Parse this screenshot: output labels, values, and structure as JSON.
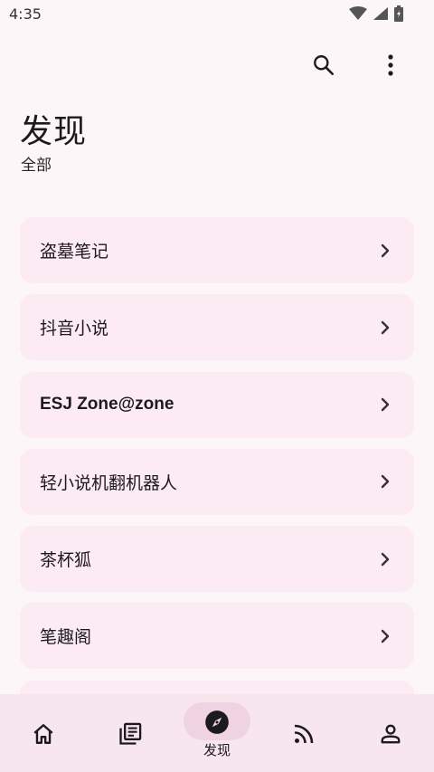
{
  "status_bar": {
    "time": "4:35"
  },
  "header": {
    "title": "发现",
    "subtitle": "全部",
    "actions": [
      {
        "icon": "search-icon"
      },
      {
        "icon": "more-vert-icon"
      }
    ]
  },
  "sources": [
    {
      "label": "盗墓笔记"
    },
    {
      "label": "抖音小说"
    },
    {
      "label": "ESJ Zone@zone"
    },
    {
      "label": "轻小说机翻机器人"
    },
    {
      "label": "茶杯狐"
    },
    {
      "label": "笔趣阁"
    },
    {
      "label": ""
    }
  ],
  "bottom_nav": {
    "items": [
      {
        "icon": "home-icon",
        "label": ""
      },
      {
        "icon": "library-icon",
        "label": ""
      },
      {
        "icon": "compass-icon",
        "label": "发现",
        "active": true
      },
      {
        "icon": "rss-icon",
        "label": ""
      },
      {
        "icon": "person-icon",
        "label": ""
      }
    ]
  },
  "colors": {
    "background": "#fdf6f9",
    "card": "#fcebf3",
    "nav": "#f7e6ee",
    "active_pill": "#f0d3e2"
  }
}
